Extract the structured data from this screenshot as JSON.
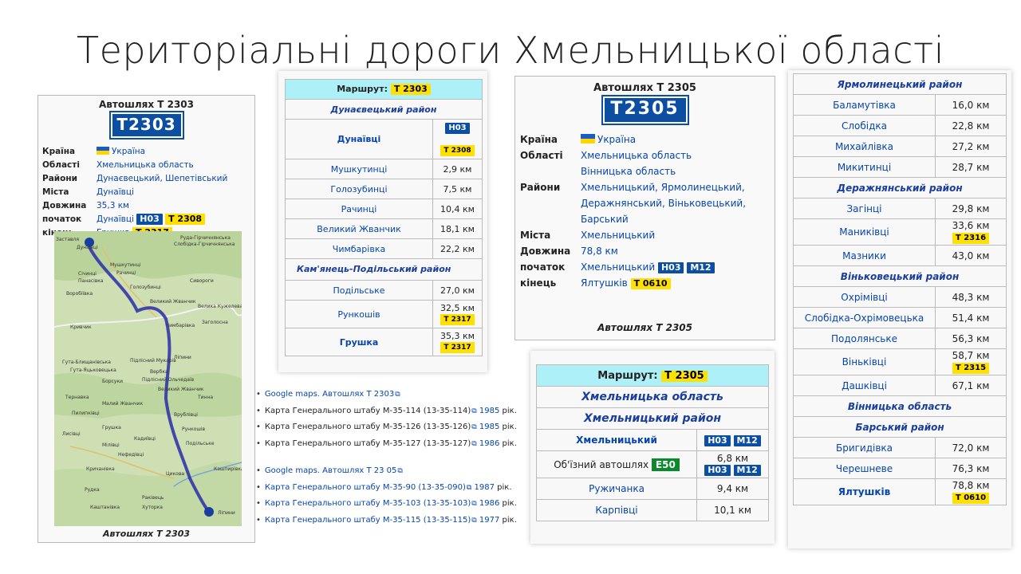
{
  "slide_title": "Територіальні дороги Хмельницької області",
  "p1": {
    "header": "Автошлях Т 2303",
    "sign": "T2303",
    "rows": [
      {
        "k": "Країна",
        "v": "Україна"
      },
      {
        "k": "Області",
        "v": "Хмельницька область"
      },
      {
        "k": "Райони",
        "v": "Дунаєвецький, Шепетівський"
      },
      {
        "k": "Міста",
        "v": "Дунаївці"
      },
      {
        "k": "Довжина",
        "v": "35,3 км"
      },
      {
        "k": "початок",
        "v": "Дунаївці",
        "b1": "H03",
        "b2": "T 2308"
      },
      {
        "k": "кінець",
        "v": "Грушка",
        "b2": "T 2317"
      }
    ],
    "map_labels": [
      "Заставля",
      "Дунаївці",
      "Руда-Гірчичнянська",
      "Слобідка-Гірчичнянська",
      "Мушкутинці",
      "Січинці",
      "Рачинці",
      "Панасівка",
      "Голозубинці",
      "Сивороги",
      "Воробіївка",
      "Великий Жванчик",
      "Велика Кужелева",
      "Кривчик",
      "Чимбарівка",
      "Заголосна",
      "Гута-Блищанівська",
      "Підлісний Мукарів",
      "Гута-Яцьковецька",
      "Вербка",
      "Ліпини",
      "Підлісний Ольчедаїв",
      "Борсуки",
      "Великий Жванчик",
      "Тернавка",
      "Малий Жванчик",
      "Тинна",
      "Пилипківці",
      "Врублівці",
      "Грушка",
      "Рункошів",
      "Лисівці",
      "Мілівці",
      "Кадиївці",
      "Подільське",
      "Нефедівці",
      "Кричанівка",
      "Кашпирівка",
      "Цикова",
      "Рудка",
      "Раківець",
      "Каштанівка",
      "Хуторка",
      "Ліпини"
    ],
    "caption": "Автошлях Т 2303"
  },
  "p2": {
    "route_label": "Маршрут:",
    "route_badge": "Т 2303",
    "rows": [
      {
        "type": "dist",
        "name": "Дунаєвецький район"
      },
      {
        "type": "place",
        "name": "Дунаївці",
        "bold": true,
        "b1": "H03",
        "b2": "T 2308"
      },
      {
        "type": "place",
        "name": "Мушкутинці",
        "km": "2,9 км"
      },
      {
        "type": "place",
        "name": "Голозубинці",
        "km": "7,5 км"
      },
      {
        "type": "place",
        "name": "Рачинці",
        "km": "10,4 км"
      },
      {
        "type": "place",
        "name": "Великий Жванчик",
        "km": "18,1 км"
      },
      {
        "type": "place",
        "name": "Чимбарівка",
        "km": "22,2 км"
      },
      {
        "type": "dist",
        "name": "Кам'янець-Подільський район"
      },
      {
        "type": "place",
        "name": "Подільське",
        "km": "27,0 км"
      },
      {
        "type": "place",
        "name": "Рункошів",
        "km": "32,5 км",
        "b2": "T 2317"
      },
      {
        "type": "place",
        "name": "Грушка",
        "bold": true,
        "km": "35,3 км",
        "b2": "T 2317"
      }
    ]
  },
  "links1": [
    {
      "text": "Google maps. Автошлях Т 2303",
      "tail": ""
    },
    {
      "text": "Карта Генерального штабу М-35-114 (13-35-114)",
      "year": "1985",
      "tail": " рік."
    },
    {
      "text": "Карта Генерального штабу М-35-126 (13-35-126)",
      "year": "1985",
      "tail": " рік."
    },
    {
      "text": "Карта Генерального штабу М-35-127 (13-35-127)",
      "year": "1986",
      "tail": " рік."
    }
  ],
  "links2": [
    {
      "text": "Google maps. Автошлях Т 23 05",
      "tail": ""
    },
    {
      "text": "Карта Генерального штабу М-35-90 (13-35-090)",
      "year": "1987",
      "tail": " рік."
    },
    {
      "text": "Карта Генерального штабу М-35-103 (13-35-103)",
      "year": "1986",
      "tail": " рік."
    },
    {
      "text": "Карта Генерального штабу М-35-115 (13-35-115)",
      "year": "1977",
      "tail": " рік."
    }
  ],
  "p3": {
    "header": "Автошлях Т 2305",
    "sign": "T2305",
    "country_k": "Країна",
    "country": "Україна",
    "oblasti_k": "Області",
    "oblasti": [
      "Хмельницька область",
      "Вінницька область"
    ],
    "raiony_k": "Райони",
    "raiony": "Хмельницький, Ярмолинецький, Деражнянський, Віньковецький, Барський",
    "mista_k": "Міста",
    "mista": "Хмельницький",
    "dovzh_k": "Довжина",
    "dovzh": "78,8 км",
    "poch_k": "початок",
    "poch": "Хмельницький",
    "poch_b1": "H03",
    "poch_b2": "M12",
    "kin_k": "кінець",
    "kin": "Ялтушків",
    "kin_b": "T 0610",
    "caption": "Автошлях Т 2305"
  },
  "p4": {
    "route_label": "Маршрут:",
    "route_badge": "Т 2305",
    "oblast": "Хмельницька область",
    "district": "Хмельницький район",
    "rows": [
      {
        "name": "Хмельницький",
        "bold": true,
        "b1": "H03",
        "b2": "M12"
      },
      {
        "name": "Об'їзний автошлях",
        "e": "E50",
        "km": "6,8 км",
        "b1": "H03",
        "b2": "M12"
      },
      {
        "name": "Ружичанка",
        "km": "9,4 км"
      },
      {
        "name": "Карпівці",
        "km": "10,1 км"
      }
    ]
  },
  "p5": {
    "rows": [
      {
        "type": "dist",
        "name": "Ярмолинецький район"
      },
      {
        "type": "place",
        "name": "Баламутівка",
        "km": "16,0 км"
      },
      {
        "type": "place",
        "name": "Слобідка",
        "km": "22,8 км"
      },
      {
        "type": "place",
        "name": "Михайлівка",
        "km": "27,2 км"
      },
      {
        "type": "place",
        "name": "Микитинці",
        "km": "28,7 км"
      },
      {
        "type": "dist",
        "name": "Деражнянський район"
      },
      {
        "type": "place",
        "name": "Загінці",
        "km": "29,8 км"
      },
      {
        "type": "place",
        "name": "Маниківці",
        "km": "33,6 км",
        "b": "T 2316"
      },
      {
        "type": "place",
        "name": "Мазники",
        "km": "43,0 км"
      },
      {
        "type": "dist",
        "name": "Віньковецький район"
      },
      {
        "type": "place",
        "name": "Охрімівці",
        "km": "48,3 км"
      },
      {
        "type": "place",
        "name": "Слобідка-Охрімовецька",
        "km": "51,4 км"
      },
      {
        "type": "place",
        "name": "Подолянське",
        "km": "56,3 км"
      },
      {
        "type": "place",
        "name": "Віньківці",
        "km": "58,7 км",
        "b": "T 2315"
      },
      {
        "type": "place",
        "name": "Дашківці",
        "km": "67,1 км"
      },
      {
        "type": "dist",
        "name": "Вінницька область"
      },
      {
        "type": "dist",
        "name": "Барський район"
      },
      {
        "type": "place",
        "name": "Бригидівка",
        "km": "72,0 км"
      },
      {
        "type": "place",
        "name": "Черешневе",
        "km": "76,3 км"
      },
      {
        "type": "place",
        "name": "Ялтушків",
        "bold": true,
        "km": "78,8 км",
        "b": "T 0610"
      }
    ]
  }
}
